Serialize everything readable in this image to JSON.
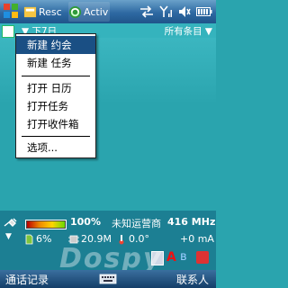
{
  "taskbar": {
    "task_1": "Resc",
    "task_2": "Activ"
  },
  "calendar_bar": {
    "title": "下7日",
    "filter": "所有条目"
  },
  "menu": {
    "items": [
      {
        "label": "新建 约会"
      },
      {
        "label": "新建 任务"
      },
      {
        "label": "打开 日历"
      },
      {
        "label": "打开任务"
      },
      {
        "label": "打开收件箱"
      },
      {
        "label": "选项..."
      }
    ]
  },
  "system_info": {
    "battery_percent": "100%",
    "battery_level": 1.0,
    "carrier": "未知运营商",
    "cpu_freq": "416 MHz",
    "storage_percent": "6%",
    "memory": "20.9M",
    "temperature": "0.0°",
    "current": "+0 mA"
  },
  "softkeys": {
    "left": "通话记录",
    "right": "联系人"
  },
  "watermark": "Dospy",
  "colors": {
    "menu_highlight": "#1a4f84",
    "background": "#2aa4ae",
    "taskbar": "#2e69a2"
  }
}
